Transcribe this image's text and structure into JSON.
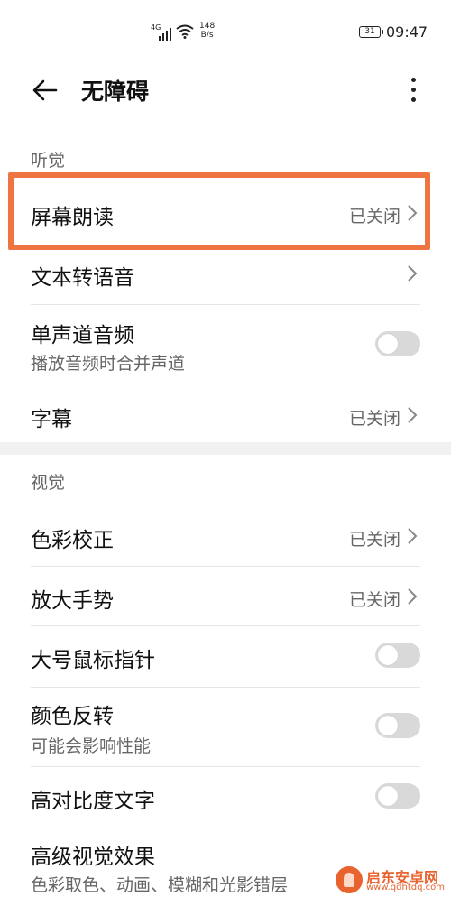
{
  "status_bar": {
    "network": "4G",
    "speed_value": "148",
    "speed_unit": "B/s",
    "battery": "31",
    "time": "09:47"
  },
  "header": {
    "title": "无障碍"
  },
  "sections": {
    "hearing": {
      "label": "听觉",
      "items": [
        {
          "title": "屏幕朗读",
          "value": "已关闭"
        },
        {
          "title": "文本转语音"
        },
        {
          "title": "单声道音频",
          "subtitle": "播放音频时合并声道",
          "toggle": false
        },
        {
          "title": "字幕",
          "value": "已关闭"
        }
      ]
    },
    "vision": {
      "label": "视觉",
      "items": [
        {
          "title": "色彩校正",
          "value": "已关闭"
        },
        {
          "title": "放大手势",
          "value": "已关闭"
        },
        {
          "title": "大号鼠标指针",
          "toggle": false
        },
        {
          "title": "颜色反转",
          "subtitle": "可能会影响性能",
          "toggle": false
        },
        {
          "title": "高对比度文字",
          "toggle": false
        },
        {
          "title": "高级视觉效果",
          "subtitle": "色彩取色、动画、模糊和光影错层"
        }
      ]
    }
  },
  "colors": {
    "highlight": "#ee7542",
    "toggle_off": "#d9d9d9"
  },
  "watermark": {
    "name": "启东安卓网",
    "url": "www.qdhtdq.com"
  }
}
